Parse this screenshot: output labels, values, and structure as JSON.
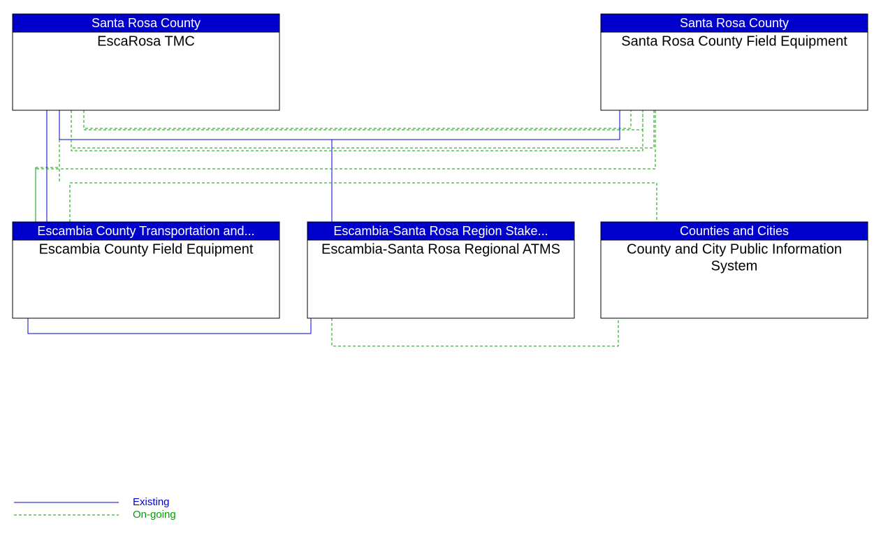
{
  "colors": {
    "existing": "#0000cc",
    "ongoing": "#00a000",
    "header_bg": "#0000cc",
    "header_text": "#ffffff",
    "body_text": "#000000"
  },
  "nodes": {
    "top_left": {
      "header": "Santa Rosa County",
      "title": "EscaRosa TMC"
    },
    "top_right": {
      "header": "Santa Rosa County",
      "title": "Santa Rosa County Field Equipment"
    },
    "bottom_left": {
      "header": "Escambia County Transportation and...",
      "title": "Escambia County Field Equipment"
    },
    "bottom_center": {
      "header": "Escambia-Santa Rosa Region Stake...",
      "title": "Escambia-Santa Rosa Regional ATMS"
    },
    "bottom_right": {
      "header": "Counties and Cities",
      "title_line1": "County and City Public Information",
      "title_line2": "System"
    }
  },
  "legend": {
    "existing": "Existing",
    "ongoing": "On-going"
  }
}
